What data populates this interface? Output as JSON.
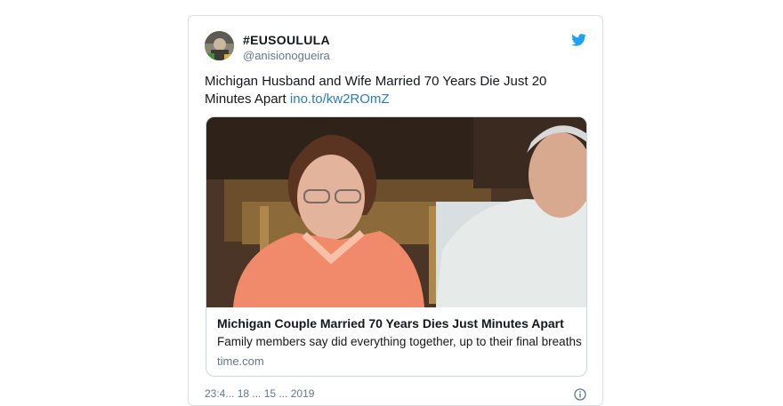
{
  "tweet": {
    "display_name": "#EUSOULULA",
    "handle": "@anisionogueira",
    "text": "Michigan Husband and Wife Married 70 Years Die Just 20 Minutes Apart ",
    "link": "ino.to/kw2ROmZ",
    "timestamp": "23:4... 18 ... 15 ... 2019",
    "icons": {
      "brand": "twitter-bird-icon",
      "info": "info-icon"
    },
    "colors": {
      "brand": "#1da1f2",
      "link": "#2b7bb9",
      "muted": "#657786"
    }
  },
  "card": {
    "title": "Michigan Couple Married 70 Years Dies Just Minutes Apart",
    "description": "Family members say did everything together, up to their final breaths",
    "domain": "time.com"
  }
}
